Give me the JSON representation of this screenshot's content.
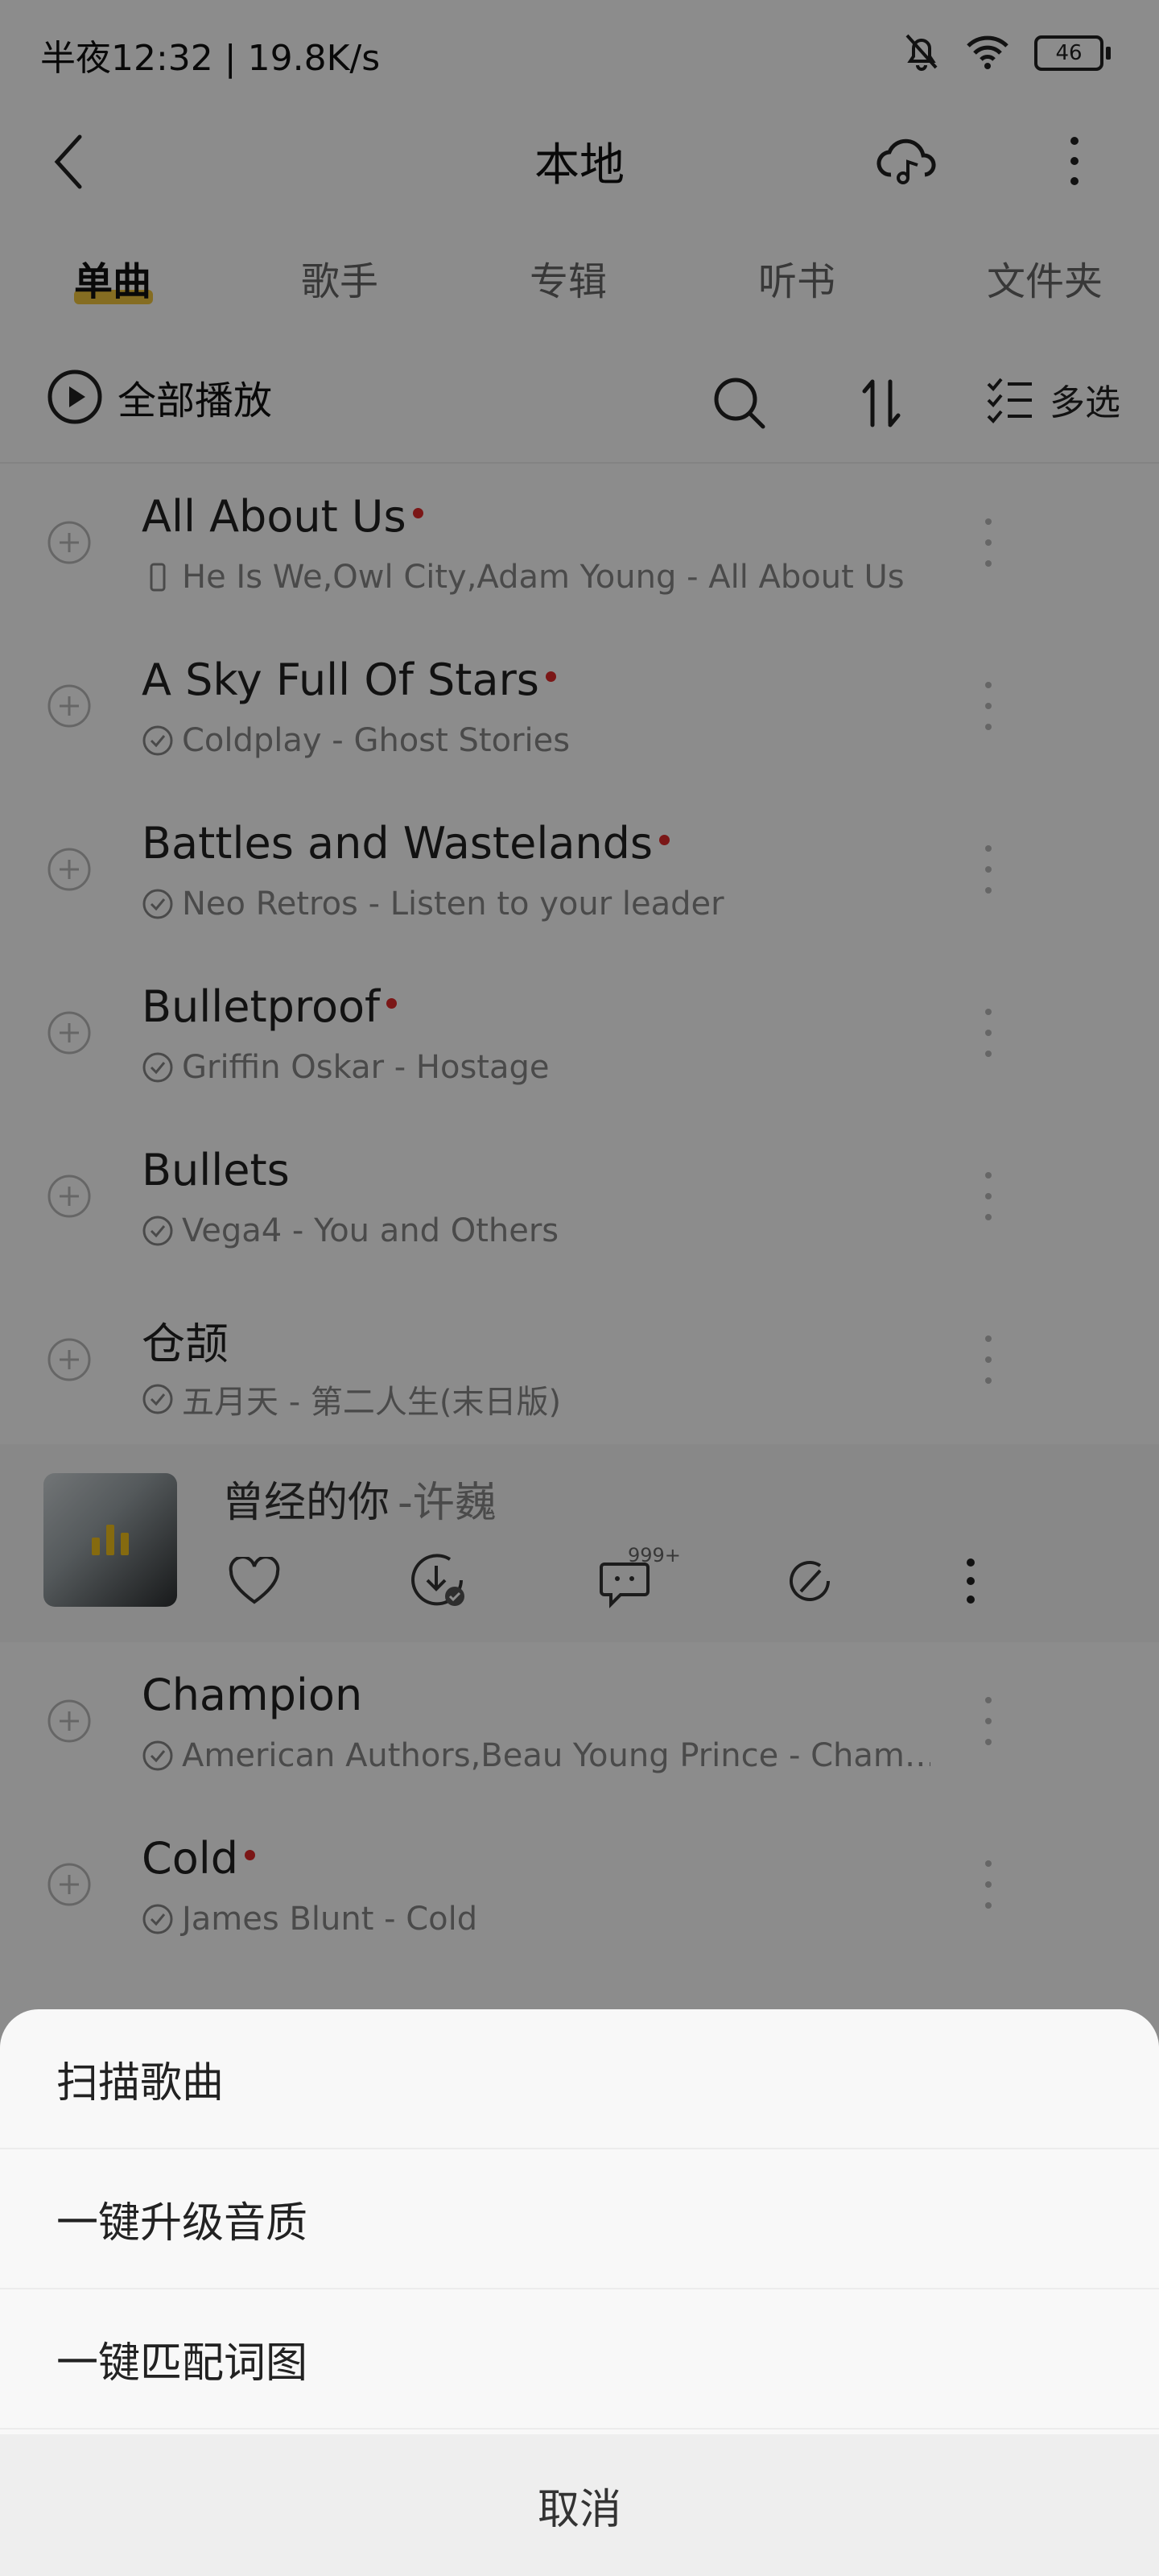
{
  "status_bar": {
    "time_and_speed": "半夜12:32 | 19.8K/s",
    "battery": "46",
    "icons": [
      "mute-bell-icon",
      "wifi-icon",
      "battery-icon"
    ]
  },
  "header": {
    "title": "本地",
    "icons": [
      "back-arrow-icon",
      "cloud-music-icon",
      "more-vertical-icon"
    ]
  },
  "tabs": [
    {
      "label": "单曲",
      "active": true
    },
    {
      "label": "歌手",
      "active": false
    },
    {
      "label": "专辑",
      "active": false
    },
    {
      "label": "听书",
      "active": false
    },
    {
      "label": "文件夹",
      "active": false
    }
  ],
  "toolbar": {
    "play_all": "全部播放",
    "multi_select": "多选",
    "icons": [
      "play-circle-icon",
      "search-icon",
      "sort-icon",
      "multi-select-icon"
    ]
  },
  "songs": [
    {
      "title": "All About Us",
      "subtitle": "He Is We,Owl City,Adam Young - All About Us",
      "new": true,
      "source_icon": "phone-icon"
    },
    {
      "title": "A Sky Full Of Stars",
      "subtitle": "Coldplay - Ghost Stories",
      "new": true,
      "source_icon": "check-circle-icon"
    },
    {
      "title": "Battles and Wastelands",
      "subtitle": "Neo Retros - Listen to your leader",
      "new": true,
      "source_icon": "check-circle-icon"
    },
    {
      "title": "Bulletproof",
      "subtitle": "Griffin Oskar - Hostage",
      "new": true,
      "source_icon": "check-circle-icon"
    },
    {
      "title": "Bullets",
      "subtitle": "Vega4 - You and Others",
      "new": false,
      "source_icon": "check-circle-icon"
    },
    {
      "title": "仓颉",
      "subtitle": "五月天 - 第二人生(末日版)",
      "new": false,
      "source_icon": "check-circle-icon"
    }
  ],
  "now_playing": {
    "title": "曾经的你",
    "artist": "-许巍",
    "comment_badge": "999+",
    "icons": [
      "heart-icon",
      "download-check-icon",
      "comment-icon",
      "share-icon",
      "more-vertical-icon"
    ]
  },
  "songs_after": [
    {
      "title": "Champion",
      "subtitle": "American Authors,Beau Young Prince - Cham…",
      "new": false,
      "source_icon": "check-circle-icon"
    },
    {
      "title": "Cold",
      "subtitle": "James Blunt - Cold",
      "new": true,
      "source_icon": "check-circle-icon"
    }
  ],
  "sheet": {
    "items": [
      "扫描歌曲",
      "一键升级音质",
      "一键匹配词图"
    ],
    "cancel": "取消"
  }
}
